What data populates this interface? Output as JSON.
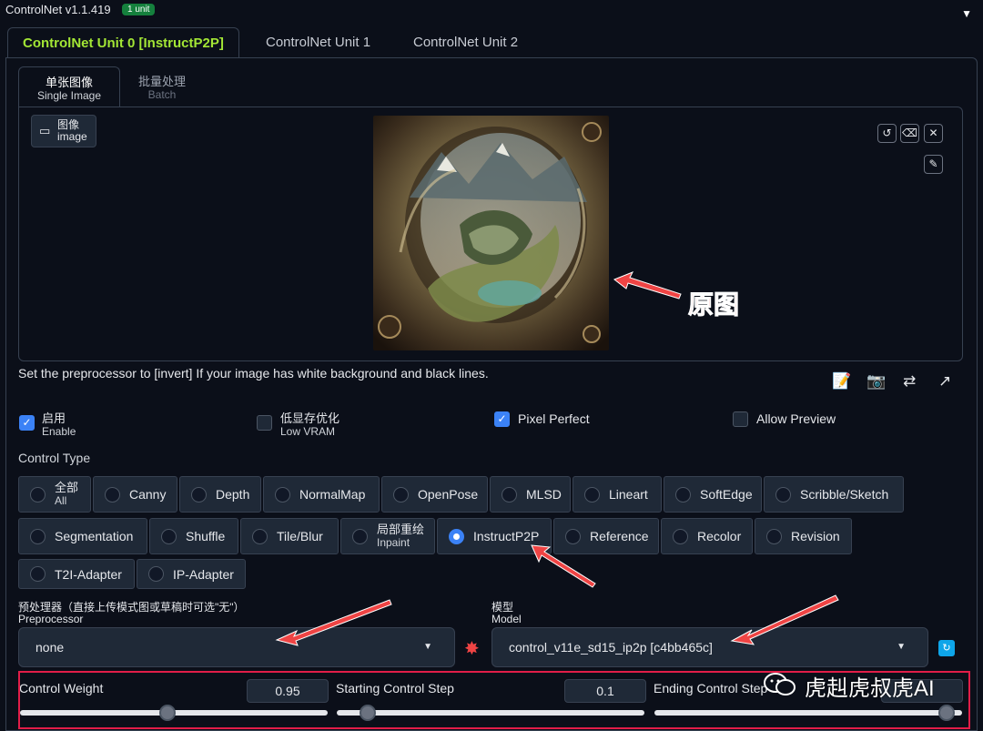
{
  "header": {
    "title": "ControlNet v1.1.419",
    "badge": "1 unit",
    "collapse_icon": "triangle-down-icon"
  },
  "unit_tabs": [
    "ControlNet Unit 0 [InstructP2P]",
    "ControlNet Unit 1",
    "ControlNet Unit 2"
  ],
  "sub_tabs": [
    {
      "label": "单张图像",
      "sub": "Single Image"
    },
    {
      "label": "批量处理",
      "sub": "Batch"
    }
  ],
  "image_label": {
    "label": "图像",
    "sub": "image"
  },
  "hint": "Set the preprocessor to [invert] If your image has white background and black lines.",
  "checkboxes": [
    {
      "label": "启用",
      "sub": "Enable",
      "checked": true
    },
    {
      "label": "低显存优化",
      "sub": "Low VRAM",
      "checked": false
    },
    {
      "label": "Pixel Perfect",
      "sub": "",
      "checked": true
    },
    {
      "label": "Allow Preview",
      "sub": "",
      "checked": false
    }
  ],
  "control_type_label": "Control Type",
  "control_types": [
    {
      "label": "全部",
      "sub": "All",
      "selected": false
    },
    {
      "label": "Canny",
      "selected": false
    },
    {
      "label": "Depth",
      "selected": false
    },
    {
      "label": "NormalMap",
      "selected": false
    },
    {
      "label": "OpenPose",
      "selected": false
    },
    {
      "label": "MLSD",
      "selected": false
    },
    {
      "label": "Lineart",
      "selected": false
    },
    {
      "label": "SoftEdge",
      "selected": false
    },
    {
      "label": "Scribble/Sketch",
      "selected": false
    },
    {
      "label": "Segmentation",
      "selected": false
    },
    {
      "label": "Shuffle",
      "selected": false
    },
    {
      "label": "Tile/Blur",
      "selected": false
    },
    {
      "label": "局部重绘",
      "sub": "Inpaint",
      "selected": false
    },
    {
      "label": "InstructP2P",
      "selected": true
    },
    {
      "label": "Reference",
      "selected": false
    },
    {
      "label": "Recolor",
      "selected": false
    },
    {
      "label": "Revision",
      "selected": false
    },
    {
      "label": "T2I-Adapter",
      "selected": false
    },
    {
      "label": "IP-Adapter",
      "selected": false
    }
  ],
  "preprocessor": {
    "label": "预处理器（直接上传模式图或草稿时可选\"无\"）",
    "sub": "Preprocessor",
    "value": "none"
  },
  "model": {
    "label": "模型",
    "sub": "Model",
    "value": "control_v11e_sd15_ip2p [c4bb465c]"
  },
  "sliders": [
    {
      "label": "Control Weight",
      "value": "0.95",
      "fraction": 0.48
    },
    {
      "label": "Starting Control Step",
      "value": "0.1",
      "fraction": 0.1
    },
    {
      "label": "Ending Control Step",
      "value": "",
      "fraction": 0.95
    }
  ],
  "annotation": "原图",
  "watermark": "虎赳虎叔虎AI",
  "colors": {
    "accent": "#a3e635",
    "checkbox": "#3b82f6",
    "annotation": "#e11d48"
  }
}
